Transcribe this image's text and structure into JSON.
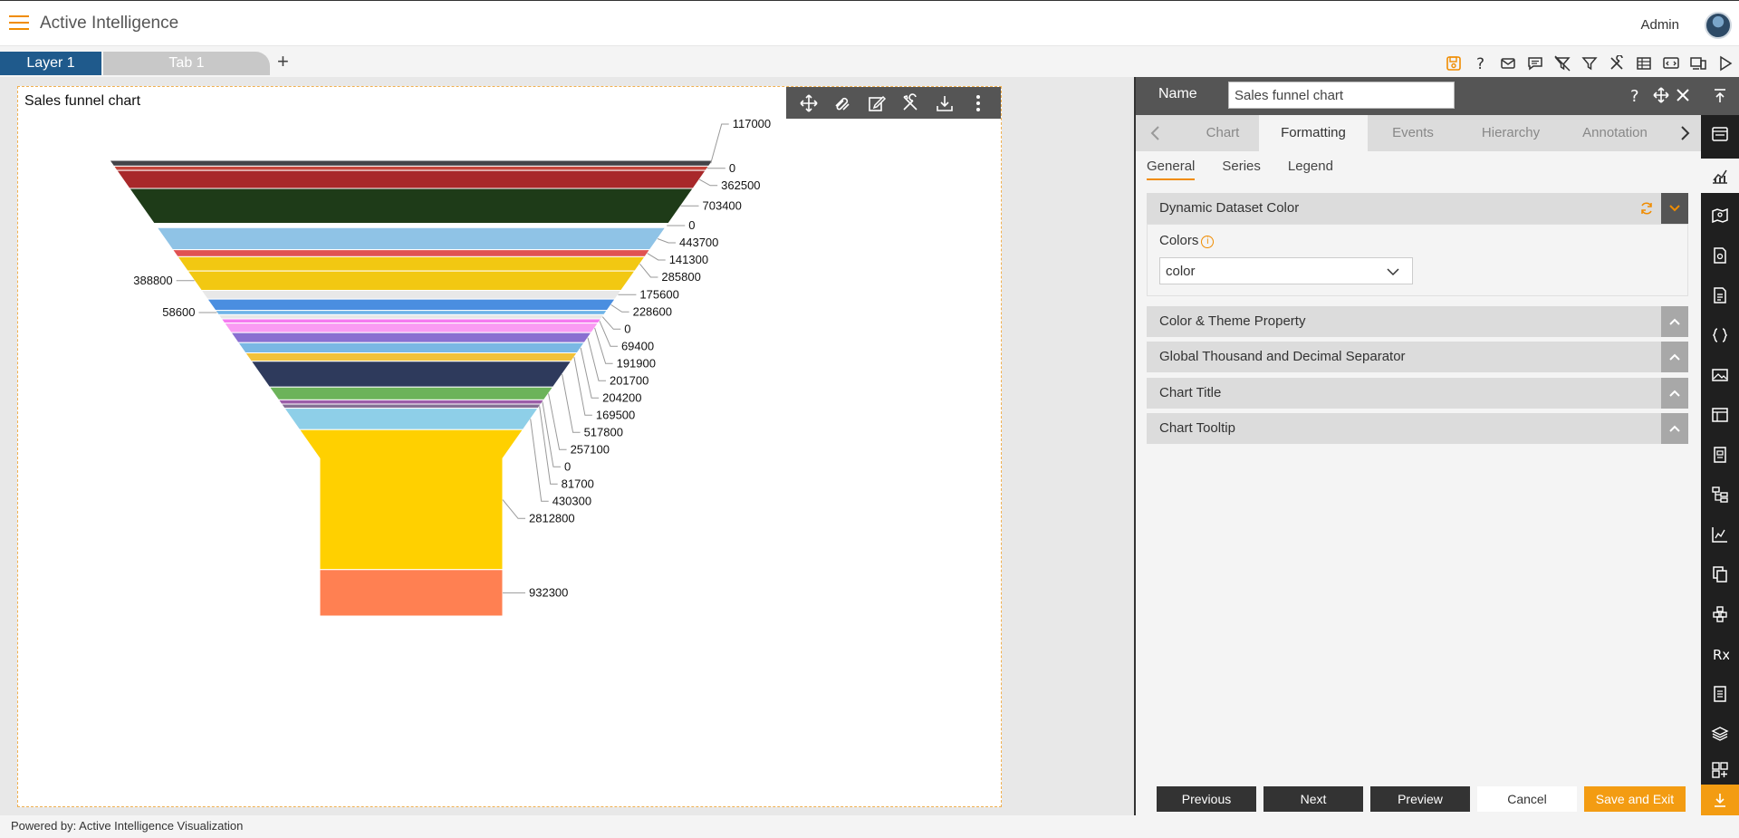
{
  "app": {
    "title": "Active Intelligence",
    "user": "Admin"
  },
  "tabs": {
    "layer": "Layer 1",
    "tab": "Tab 1",
    "add": "+"
  },
  "toolbar_icons": [
    "save-icon",
    "help-icon",
    "mail-icon",
    "comment-icon",
    "clear-filter-icon",
    "filter-icon",
    "tools-icon",
    "table-icon",
    "embed-icon",
    "devices-icon",
    "play-icon"
  ],
  "chart": {
    "title": "Sales funnel chart",
    "toolbar_icons": [
      "move-icon",
      "link-icon",
      "edit-icon",
      "settings-icon",
      "download-icon",
      "more-icon"
    ]
  },
  "chart_data": {
    "type": "funnel",
    "title": "Sales funnel chart",
    "values": [
      117000,
      0,
      362500,
      703400,
      0,
      443700,
      141300,
      285800,
      388800,
      175600,
      228600,
      58600,
      0,
      69400,
      191900,
      201700,
      204200,
      169500,
      517800,
      257100,
      0,
      81700,
      430300,
      2812800,
      932300
    ],
    "colors": [
      "#434348",
      "#c4453c",
      "#a8282a",
      "#1e3b18",
      "#ffffff",
      "#8fc3e6",
      "#e05252",
      "#f2c812",
      "#f2c812",
      "#e8e8e8",
      "#4a8ee0",
      "#6fb4e8",
      "#e8e8e8",
      "#f57af0",
      "#fa9bf3",
      "#8a6fd1",
      "#7ab8e4",
      "#f2c23a",
      "#2e3a5c",
      "#6cb35a",
      "#9b5ea8",
      "#857095",
      "#8ecfe8",
      "#ffd000",
      "#ff8052",
      "#ffb800",
      "#e0f800"
    ],
    "labels_left": [
      "388800",
      "58600"
    ],
    "labels_right": [
      "117000",
      "0",
      "362500",
      "703400",
      "0",
      "443700",
      "141300",
      "285800",
      "175600",
      "228600",
      "0",
      "69400",
      "191900",
      "201700",
      "204200",
      "169500",
      "517800",
      "257100",
      "0",
      "81700",
      "430300",
      "2812800",
      "932300"
    ]
  },
  "panel": {
    "name_label": "Name",
    "name_value": "Sales funnel chart",
    "tabs": [
      "Chart",
      "Formatting",
      "Events",
      "Hierarchy",
      "Annotation"
    ],
    "active_tab": "Formatting",
    "subtabs": [
      "General",
      "Series",
      "Legend"
    ],
    "sections": {
      "dynamic": "Dynamic Dataset Color",
      "colors_label": "Colors",
      "colors_value": "color",
      "theme": "Color & Theme Property",
      "separator": "Global Thousand and Decimal Separator",
      "chart_title": "Chart Title",
      "tooltip": "Chart Tooltip"
    },
    "buttons": {
      "previous": "Previous",
      "next": "Next",
      "preview": "Preview",
      "cancel": "Cancel",
      "save_exit": "Save and Exit"
    }
  },
  "footer": "Powered by: Active Intelligence Visualization",
  "accent_color": "#f08c00"
}
